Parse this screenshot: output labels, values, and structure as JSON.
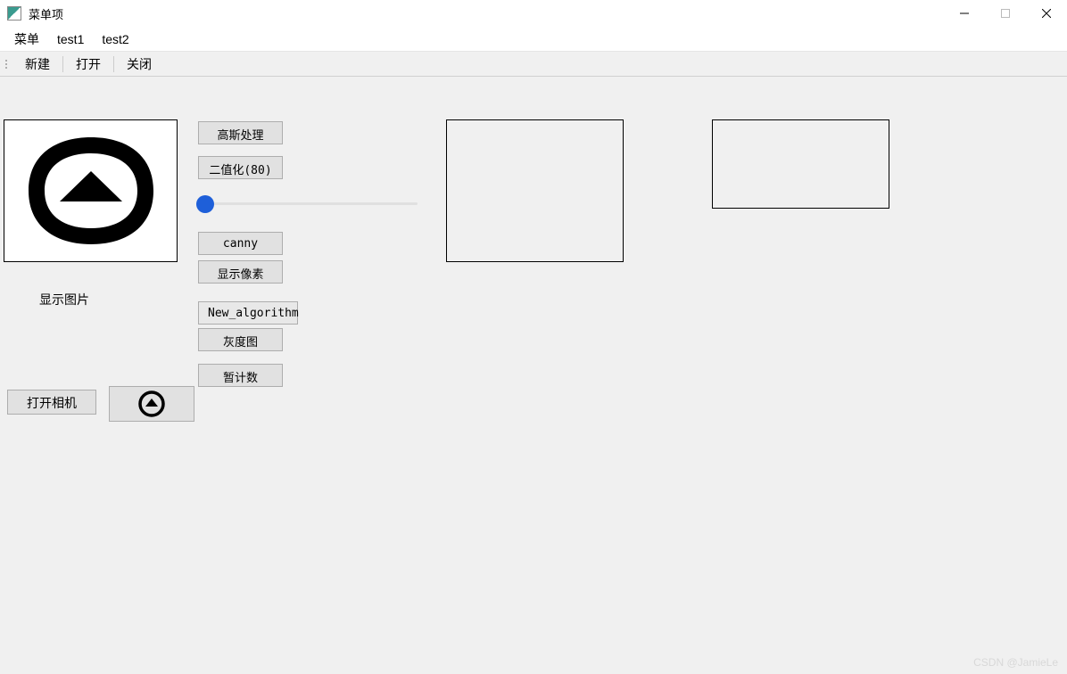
{
  "window": {
    "title": "菜单项"
  },
  "menubar": {
    "items": [
      "菜单",
      "test1",
      "test2"
    ]
  },
  "toolbar": {
    "new": "新建",
    "open": "打开",
    "close": "关闭"
  },
  "main": {
    "image_label": "显示图片",
    "buttons": {
      "gauss": "高斯处理",
      "binary": "二值化(80)",
      "canny": "canny",
      "pixels": "显示像素",
      "new_algorithm": "New_algorithm",
      "gray": "灰度图",
      "count": "暂计数",
      "open_camera": "打开相机"
    },
    "slider": {
      "value": 0,
      "min": 0,
      "max": 255
    }
  },
  "watermark": "CSDN @JamieLe"
}
